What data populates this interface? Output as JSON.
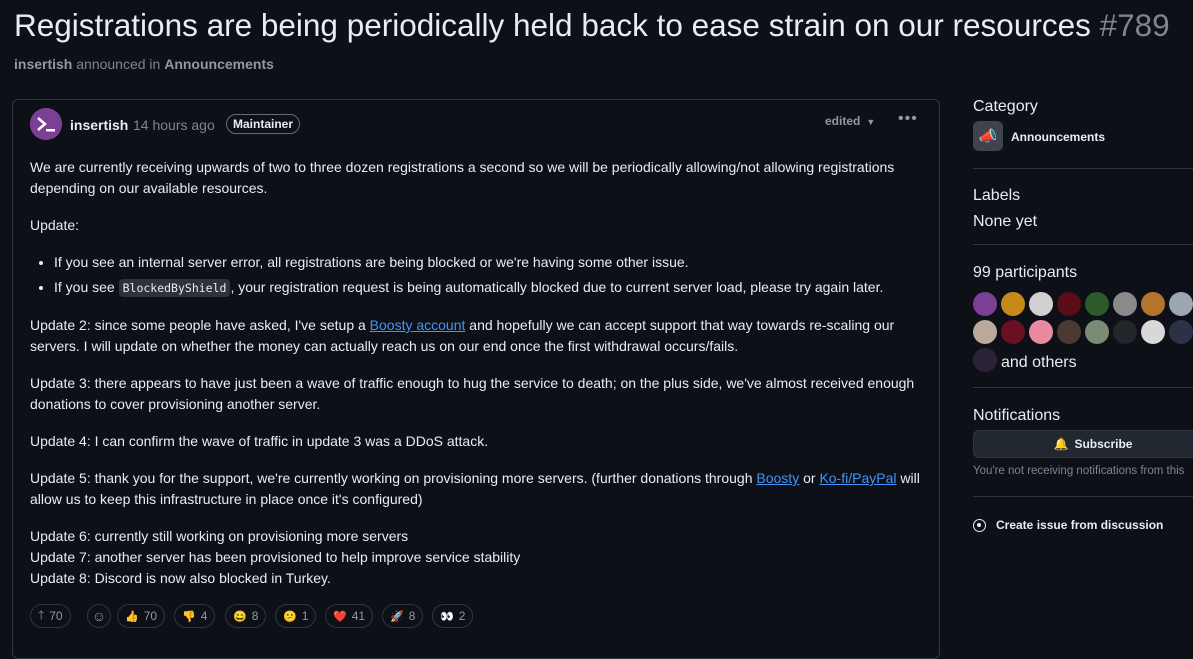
{
  "discussion": {
    "title": "Registrations are being periodically held back to ease strain on our resources",
    "number": "#789",
    "author": "insertish",
    "announced_text": "announced in",
    "category": "Announcements"
  },
  "post": {
    "author": "insertish",
    "time": "14 hours ago",
    "badge": "Maintainer",
    "edited": "edited",
    "p1": "We are currently receiving upwards of two to three dozen registrations a second so we will be periodically allowing/not allowing registrations depending on our available resources.",
    "update_label": "Update:",
    "li1": "If you see an internal server error, all registrations are being blocked or we're having some other issue.",
    "li2_pre": "If you see ",
    "li2_code": "BlockedByShield",
    "li2_post": ", your registration request is being automatically blocked due to current server load, please try again later.",
    "u2_pre": "Update 2: since some people have asked, I've setup a ",
    "u2_link": "Boosty account",
    "u2_post": " and hopefully we can accept support that way towards re-scaling our servers. I will update on whether the money can actually reach us on our end once the first withdrawal occurs/fails.",
    "u3": "Update 3: there appears to have just been a wave of traffic enough to hug the service to death; on the plus side, we've almost received enough donations to cover provisioning another server.",
    "u4": "Update 4: I can confirm the wave of traffic in update 3 was a DDoS attack.",
    "u5_pre": "Update 5: thank you for the support, we're currently working on provisioning more servers. (further donations through ",
    "u5_link1": "Boosty",
    "u5_mid": " or ",
    "u5_link2": "Ko-fi/PayPal",
    "u5_post": " will allow us to keep this infrastructure in place once it's configured)",
    "u6": "Update 6: currently still working on provisioning more servers",
    "u7": "Update 7: another server has been provisioned to help improve service stability",
    "u8": "Update 8: Discord is now also blocked in Turkey."
  },
  "reactions": {
    "upvote": "70",
    "items": [
      {
        "emoji": "👍",
        "count": "70"
      },
      {
        "emoji": "👎",
        "count": "4"
      },
      {
        "emoji": "😄",
        "count": "8"
      },
      {
        "emoji": "😕",
        "count": "1"
      },
      {
        "emoji": "❤️",
        "count": "41"
      },
      {
        "emoji": "🚀",
        "count": "8"
      },
      {
        "emoji": "👀",
        "count": "2"
      }
    ]
  },
  "sidebar": {
    "category_head": "Category",
    "category_name": "Announcements",
    "labels_head": "Labels",
    "labels_val": "None yet",
    "participants_head": "99 participants",
    "and_others": "and others",
    "notifications_head": "Notifications",
    "subscribe": "Subscribe",
    "sub_note": "You're not receiving notifications from this",
    "create_issue": "Create issue from discussion"
  },
  "colors": {
    "link": "#4493f8",
    "background": "#0d1117",
    "border": "#30363d"
  }
}
